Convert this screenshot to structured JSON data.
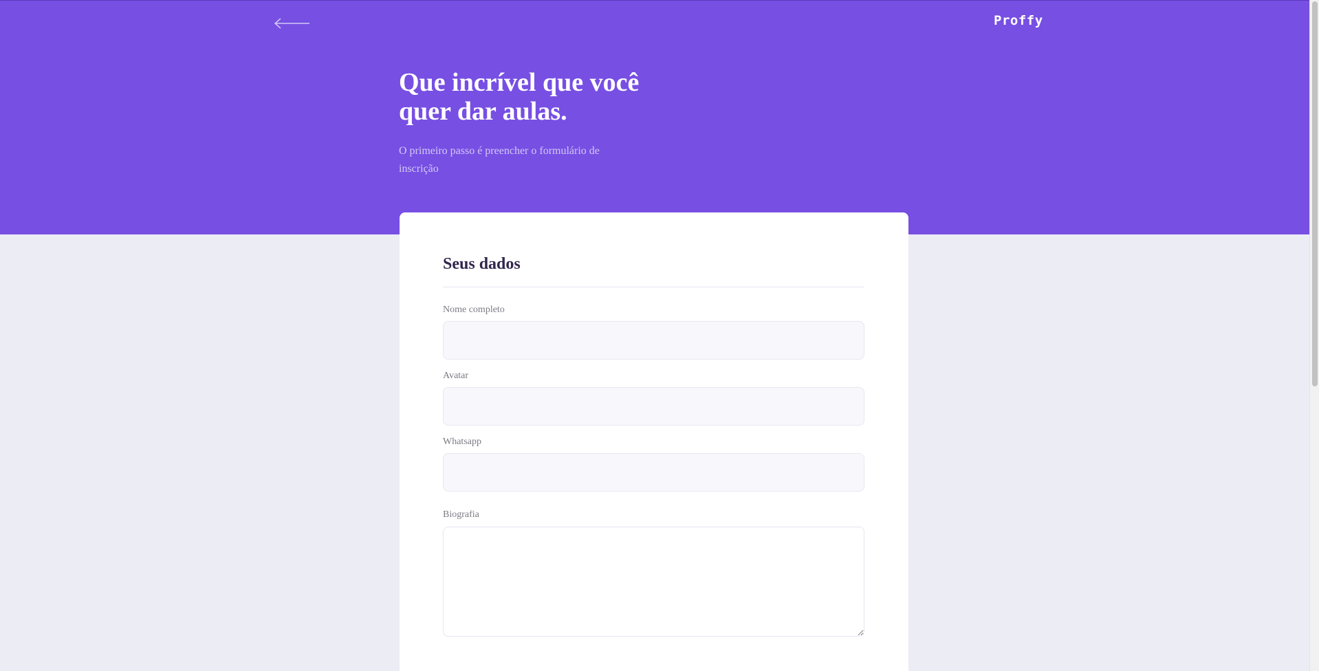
{
  "header": {
    "back_icon": "arrow-left-icon",
    "logo_text": "Proffy",
    "title": "Que incrível que você quer dar aulas.",
    "subtitle": "O primeiro passo é preencher o formulário de inscrição"
  },
  "form": {
    "section_title": "Seus dados",
    "fields": [
      {
        "label": "Nome completo",
        "value": "",
        "type": "input"
      },
      {
        "label": "Avatar",
        "value": "",
        "type": "input"
      },
      {
        "label": "Whatsapp",
        "value": "",
        "type": "input"
      },
      {
        "label": "Biografia",
        "value": "",
        "type": "textarea"
      }
    ]
  },
  "colors": {
    "primary": "#774fe3",
    "background": "#ececf5",
    "card": "#ffffff",
    "title_text": "#32264d",
    "label_text": "#7b7a85",
    "input_bg": "#f8f8fc",
    "input_border": "#e6e6f0"
  }
}
